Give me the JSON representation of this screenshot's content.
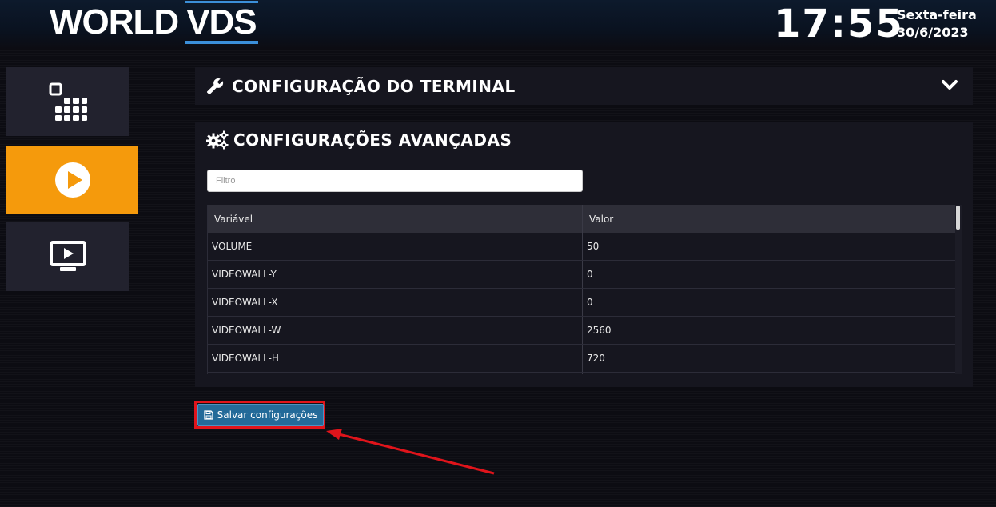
{
  "header": {
    "logo_world": "WORLD",
    "logo_vds": "VDS",
    "time": "17:55",
    "weekday": "Sexta-feira",
    "date": "30/6/2023"
  },
  "sidebar": {
    "items": [
      {
        "icon": "grid-apps-icon",
        "active": false
      },
      {
        "icon": "play-circle-icon",
        "active": true
      },
      {
        "icon": "monitor-play-icon",
        "active": false
      }
    ]
  },
  "terminal_panel": {
    "title": "CONFIGURAÇÃO DO TERMINAL",
    "icon": "wrench-icon",
    "toggle_icon": "chevron-down-icon"
  },
  "advanced_panel": {
    "title": "CONFIGURAÇÕES AVANÇADAS",
    "icon": "gears-icon",
    "filter_placeholder": "Filtro",
    "table": {
      "headers": [
        "Variável",
        "Valor"
      ],
      "rows": [
        [
          "VOLUME",
          "50"
        ],
        [
          "VIDEOWALL-Y",
          "0"
        ],
        [
          "VIDEOWALL-X",
          "0"
        ],
        [
          "VIDEOWALL-W",
          "2560"
        ],
        [
          "VIDEOWALL-H",
          "720"
        ]
      ]
    }
  },
  "save_button": {
    "label": "Salvar configurações",
    "icon": "floppy-disk-icon"
  },
  "colors": {
    "accent_orange": "#f59a0c",
    "logo_blue": "#3b8fd9",
    "button_blue": "#236a99",
    "highlight_red": "#e0141b"
  }
}
